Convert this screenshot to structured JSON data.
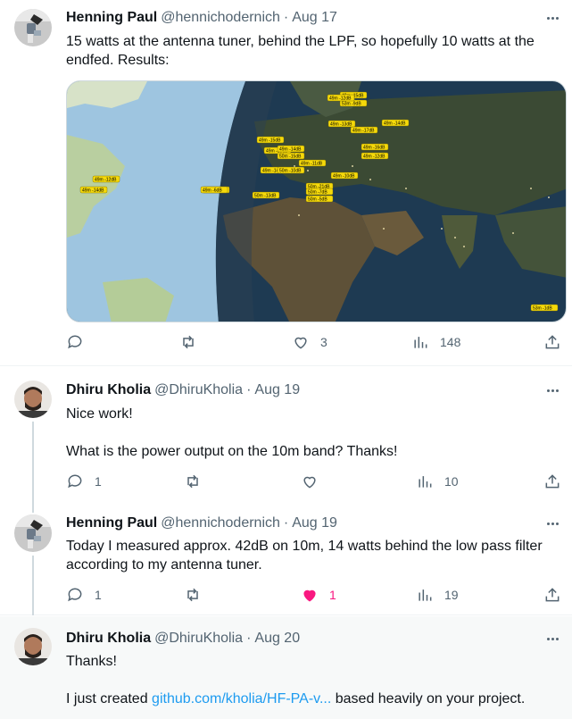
{
  "tweets": [
    {
      "name": "Henning Paul",
      "handle": "@hennichodernich",
      "date": "Aug 17",
      "text": [
        "15 watts at the antenna tuner, behind the LPF, so hopefully 10 watts at the",
        "endfed. Results:"
      ],
      "replies": "",
      "retweets": "",
      "likes": "3",
      "views": "148",
      "liked": false
    },
    {
      "name": "Dhiru Kholia",
      "handle": "@DhiruKholia",
      "date": "Aug 19",
      "text": [
        "Nice work!",
        "What is the power output on the 10m band? Thanks!"
      ],
      "replies": "1",
      "retweets": "",
      "likes": "",
      "views": "10",
      "liked": false
    },
    {
      "name": "Henning Paul",
      "handle": "@hennichodernich",
      "date": "Aug 19",
      "text": [
        "Today I measured approx. 42dB on 10m, 14 watts behind the low pass filter",
        "according to my antenna tuner."
      ],
      "replies": "1",
      "retweets": "",
      "likes": "1",
      "views": "19",
      "liked": true
    },
    {
      "name": "Dhiru Kholia",
      "handle": "@DhiruKholia",
      "date": "Aug 20",
      "text_1": "Thanks!",
      "text_2_before": "I just created ",
      "text_2_link": "github.com/kholia/HF-PA-v...",
      "text_2_after": " based heavily on your project."
    }
  ],
  "map_spots": [
    "49m -15dB",
    "53m -9dB",
    "49m -12dB",
    "49m -17dB",
    "49m -13dB",
    "49m -14dB",
    "50m -15dB",
    "49m -15dB",
    "49m -13dB",
    "49m -14dB",
    "49m -11dB",
    "49m -16dB",
    "49m -12dB",
    "49m -14dB",
    "49m -6dB",
    "50m -10dB",
    "50m -21dB",
    "49m -10dB",
    "50m -7dB",
    "50m -13dB",
    "50m -5dB",
    "49m -12dB",
    "49m -14dB",
    "49m -6dB",
    "53m -1dB"
  ],
  "colors": {
    "accent": "#1d9bf0",
    "like": "#f91880",
    "muted": "#536471",
    "spot_fill": "#f5d90a"
  },
  "icons": [
    "reply-icon",
    "retweet-icon",
    "like-icon",
    "views-icon",
    "share-icon",
    "more-icon"
  ]
}
